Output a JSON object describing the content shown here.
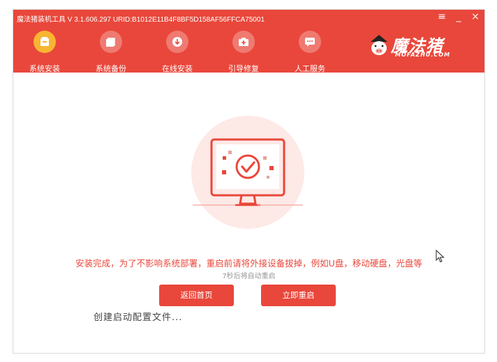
{
  "window": {
    "title": "魔法猪装机工具 V 3.1.606.297 URID:B1012E11B4F8BF5D158AF56FFCA75001",
    "controls": {
      "menu": "≡",
      "minimize": "_",
      "close": "×"
    }
  },
  "nav": {
    "items": [
      {
        "label": "系统安装",
        "icon": "system-install-icon",
        "active": true
      },
      {
        "label": "系统备份",
        "icon": "system-backup-icon",
        "active": false
      },
      {
        "label": "在线安装",
        "icon": "online-install-icon",
        "active": false
      },
      {
        "label": "引导修复",
        "icon": "boot-repair-icon",
        "active": false
      },
      {
        "label": "人工服务",
        "icon": "support-chat-icon",
        "active": false
      }
    ]
  },
  "logo": {
    "text": "魔法猪",
    "subtext": "MOFAZHU.COM"
  },
  "main": {
    "message": "安装完成，为了不影响系统部署，重启前请将外接设备拔掉，例如U盘，移动硬盘，光盘等",
    "countdown": "7秒后将自动重启",
    "buttons": {
      "home": "返回首页",
      "restart": "立即重启"
    },
    "progress_text": "创建启动配置文件..."
  },
  "colors": {
    "accent": "#e9473b",
    "active_nav": "#f9b531",
    "hero_bg": "#fde9e6"
  }
}
